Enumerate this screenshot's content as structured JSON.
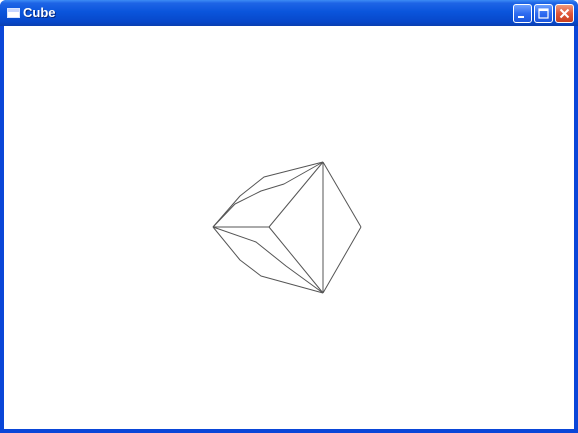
{
  "window": {
    "title": "Cube",
    "icon": "window-icon",
    "controls": {
      "minimize_icon": "minimize-icon",
      "maximize_icon": "maximize-icon",
      "close_icon": "close-icon"
    },
    "colors": {
      "titlebar": "#0a55dc",
      "close_button": "#e0573a",
      "client_background": "#ffffff",
      "line": "#555555"
    }
  }
}
